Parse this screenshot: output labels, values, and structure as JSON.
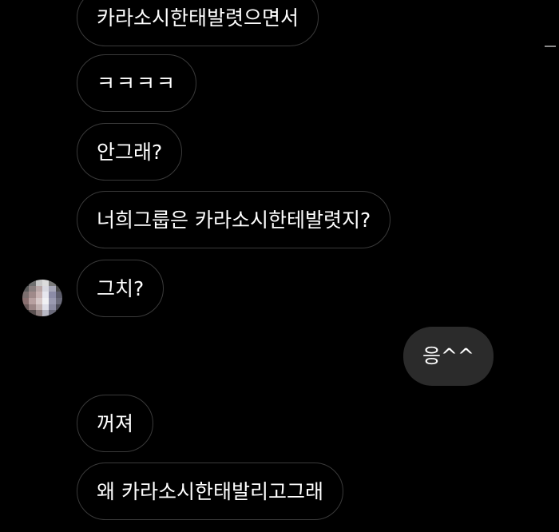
{
  "messages": [
    {
      "text": "카라소시한태발렷으면서",
      "side": "in"
    },
    {
      "text": "ㅋㅋㅋㅋ",
      "side": "in"
    },
    {
      "text": "안그래?",
      "side": "in"
    },
    {
      "text": "너희그룹은 카라소시한테발렷지?",
      "side": "in"
    },
    {
      "text": "그치?",
      "side": "in"
    },
    {
      "text": "응^^",
      "side": "out"
    },
    {
      "text": "꺼져",
      "side": "in"
    },
    {
      "text": "왜 카라소시한태발리고그래",
      "side": "in"
    }
  ],
  "sender_avatar": {
    "icon": "pixelated-avatar-icon"
  },
  "colors": {
    "background": "#000000",
    "incoming_border": "#3a3a3a",
    "outgoing_bg": "#2b2b2b",
    "text": "#ffffff"
  }
}
